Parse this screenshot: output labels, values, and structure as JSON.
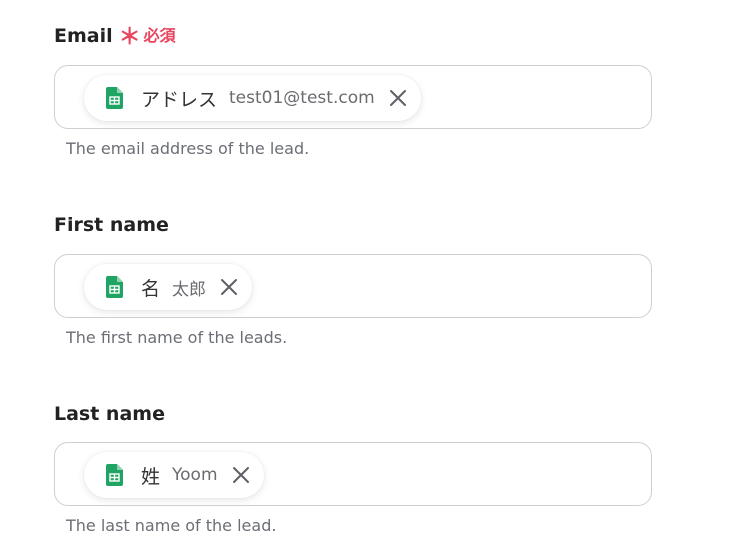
{
  "fields": [
    {
      "label": "Email",
      "required_marker": "＊",
      "required_text": "必須",
      "chip": {
        "label": "アドレス",
        "value": "test01@test.com",
        "icon": "google-sheets-icon"
      },
      "help": "The email address of the lead."
    },
    {
      "label": "First name",
      "chip": {
        "label": "名",
        "value": "太郎",
        "icon": "google-sheets-icon"
      },
      "help": "The first name of the leads."
    },
    {
      "label": "Last name",
      "chip": {
        "label": "姓",
        "value": "Yoom",
        "icon": "google-sheets-icon"
      },
      "help": "The last name of the lead."
    }
  ],
  "colors": {
    "required": "#e8455e",
    "sheets_green": "#1fa463",
    "border": "#cfcfd3",
    "help_text": "#6b6e75"
  }
}
